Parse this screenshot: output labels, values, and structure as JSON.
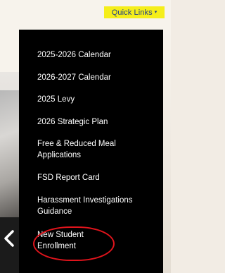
{
  "quick_links": {
    "label": "Quick Links",
    "caret": "▾",
    "button_color": "#f5ee1a",
    "text_color": "#1e3d8a"
  },
  "dropdown": {
    "background": "#000000",
    "items": [
      {
        "label": "2025-2026 Calendar"
      },
      {
        "label": "2026-2027 Calendar"
      },
      {
        "label": "2025 Levy"
      },
      {
        "label": "2026 Strategic Plan"
      },
      {
        "label": "Free & Reduced Meal Applications"
      },
      {
        "label": "FSD Report Card"
      },
      {
        "label": "Harassment Investigations Guidance"
      },
      {
        "label": "New Student Enrollment"
      }
    ],
    "highlight_color": "#e0141c"
  }
}
